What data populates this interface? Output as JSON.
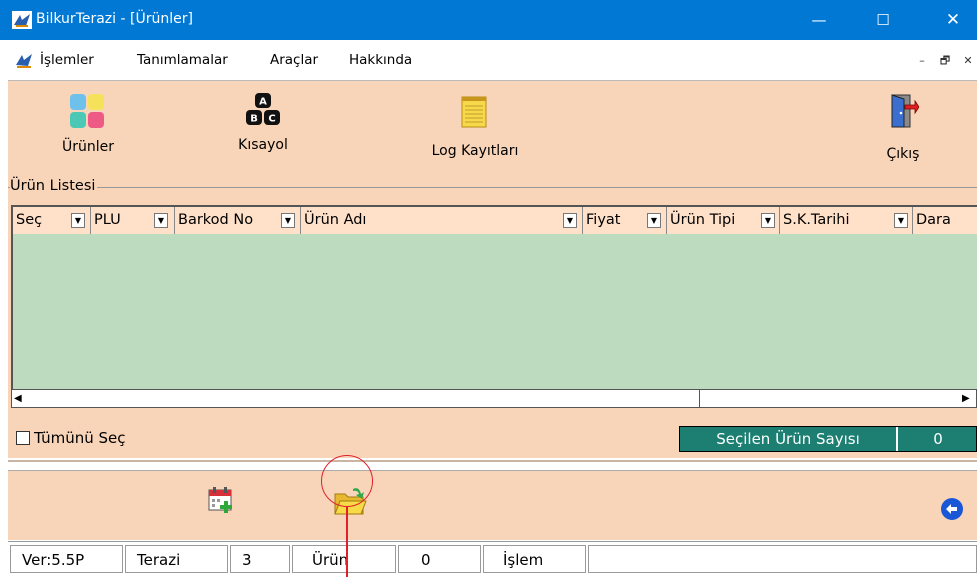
{
  "window": {
    "title": "BilkurTerazi  - [Ürünler]",
    "controls": {
      "minimize": "—",
      "maximize": "☐",
      "close": "✕"
    }
  },
  "menu": {
    "items": [
      "İşlemler",
      "Tanımlamalar",
      "Araçlar",
      "Hakkında"
    ],
    "mdi_controls": {
      "minimize": "–",
      "restore": "🗗",
      "close": "✕"
    }
  },
  "toolbar": {
    "products": "Ürünler",
    "shortcut": "Kısayol",
    "log": "Log Kayıtları",
    "exit": "Çıkış"
  },
  "product_list": {
    "group_title": "Ürün Listesi",
    "columns": [
      "Seç",
      "PLU",
      "Barkod No",
      "Ürün Adı",
      "Fiyat",
      "Ürün Tipi",
      "S.K.Tarihi",
      "Dara"
    ],
    "rows": [],
    "select_all_label": "Tümünü Seç",
    "selected_count_label": "Seçilen Ürün Sayısı",
    "selected_count": "0"
  },
  "status": {
    "version": "Ver:5.5P",
    "scale_label": "Terazi",
    "scale_value": "3",
    "product_label": "Ürün",
    "product_value": "0",
    "operation_label": "İşlem"
  },
  "colors": {
    "titlebar": "#0078d4",
    "panel": "#f8d5b8",
    "grid_background": "#bddcbf",
    "count_box": "#1c7f72",
    "annotation": "#e0202b"
  },
  "icons": {
    "app": "scale-logo-icon",
    "products": "color-tiles-icon",
    "shortcut": "abc-keys-icon",
    "log": "notepad-icon",
    "exit": "exit-door-icon",
    "add_date": "calendar-add-icon",
    "open_folder": "open-folder-icon",
    "back": "back-arrow-icon"
  }
}
